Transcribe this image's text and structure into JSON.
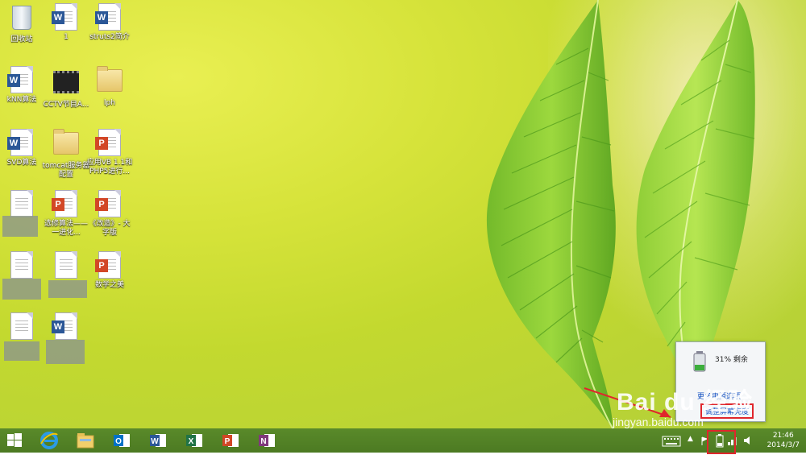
{
  "desktop": {
    "icons": [
      {
        "label": "回收站",
        "type": "recycle-bin"
      },
      {
        "label": "1",
        "type": "word"
      },
      {
        "label": "struts2简介",
        "type": "word"
      },
      {
        "label": "kNN算法",
        "type": "word"
      },
      {
        "label": "CCTV节目A...",
        "type": "video"
      },
      {
        "label": "lph",
        "type": "folder"
      },
      {
        "label": "SVD算法",
        "type": "word"
      },
      {
        "label": "tomcat服务器配置",
        "type": "folder"
      },
      {
        "label": "应用VB 1.1和PHP5进行...",
        "type": "pdf"
      },
      {
        "label": "选修算法——一进化...",
        "type": "pdf"
      },
      {
        "label": "《改造》- 大字版",
        "type": "pdf"
      },
      {
        "label": "数学之美",
        "type": "pdf"
      }
    ]
  },
  "battery_popup": {
    "percent_text": "31% 剩余",
    "link1": "更多电源选项",
    "link2": "调整屏幕亮度"
  },
  "watermark": {
    "brand": "Bai du 经验",
    "url": "jingyan.baidu.com"
  },
  "taskbar": {
    "apps": [
      "start",
      "internet-explorer",
      "file-explorer",
      "outlook",
      "word",
      "excel",
      "powerpoint",
      "onenote"
    ],
    "clock_time": "21:46",
    "clock_date": "2014/3/7"
  },
  "colors": {
    "taskbar": "#4c7a22",
    "highlight": "#e0262c",
    "word": "#2b5797",
    "excel": "#217346",
    "powerpoint": "#d24726",
    "onenote": "#80397b",
    "outlook": "#0072c6"
  }
}
